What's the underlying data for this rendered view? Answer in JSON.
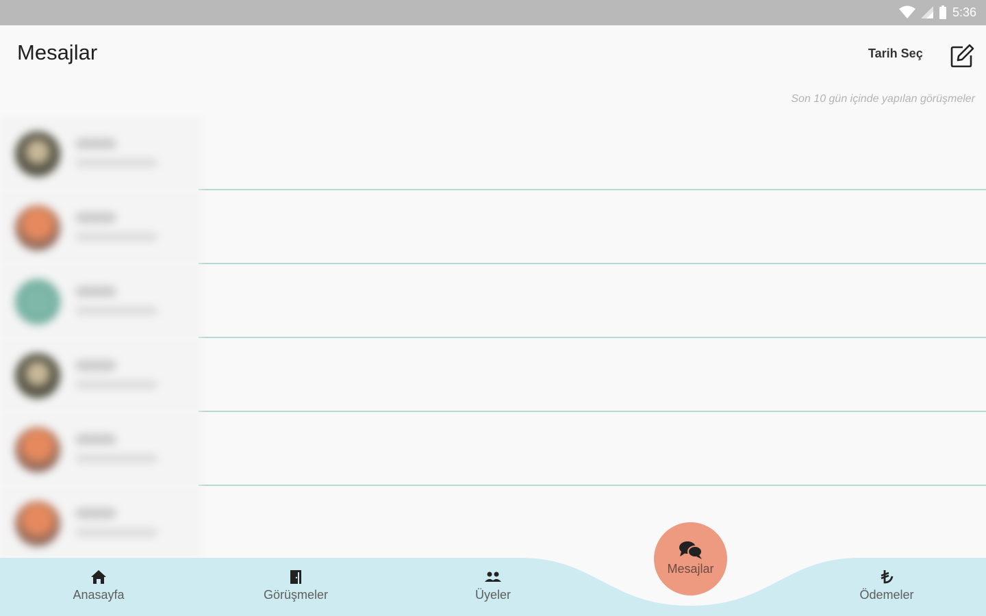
{
  "status_bar": {
    "time": "5:36",
    "icons": [
      "wifi-icon",
      "signal-icon",
      "battery-icon"
    ]
  },
  "header": {
    "title": "Mesajlar",
    "date_picker_label": "Tarih Seç",
    "compose_icon": "compose-icon"
  },
  "subtitle": "Son 10 gün içinde yapılan görüşmeler",
  "conversations": [
    {
      "avatar_color": "#6b6b5a"
    },
    {
      "avatar_color": "#c8785a"
    },
    {
      "avatar_color": "#6fa89a"
    },
    {
      "avatar_color": "#6b6b5a"
    },
    {
      "avatar_color": "#c8785a"
    },
    {
      "avatar_color": "#c8785a"
    }
  ],
  "bottom_nav": {
    "items": [
      {
        "label": "Anasayfa",
        "icon": "home-icon"
      },
      {
        "label": "Görüşmeler",
        "icon": "door-icon"
      },
      {
        "label": "Üyeler",
        "icon": "users-icon"
      },
      {
        "label": "Mesajlar",
        "icon": "chat-icon",
        "active": true
      },
      {
        "label": "Ödemeler",
        "icon": "lira-icon"
      }
    ]
  },
  "colors": {
    "nav_background": "#cdebf1",
    "active_fab": "#ee9a80",
    "divider": "#b5d8d5",
    "status_bar": "#b9b9b9"
  }
}
